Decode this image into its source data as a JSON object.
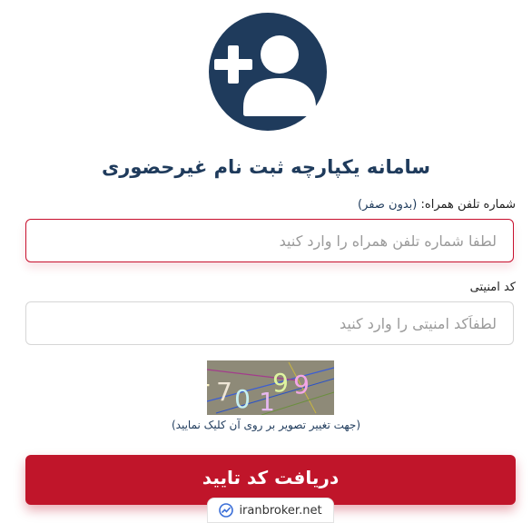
{
  "header": {
    "icon": "user-plus-icon",
    "title": "سامانه یکپارچه ثبت نام غیرحضوری",
    "accent_color": "#1f3b5c"
  },
  "phone": {
    "label": "شماره تلفن همراه:",
    "hint": "(بدون صفر)",
    "placeholder": "لطفا شماره تلفن همراه را وارد کنید"
  },
  "security": {
    "label": "کد امنیتی",
    "placeholder": "لطفاًکد امنیتی را وارد کنید"
  },
  "captcha": {
    "digits": [
      "1",
      "7",
      "0",
      "1",
      "9",
      "9"
    ],
    "hint": "(جهت تغییر تصویر بر روی آن کلیک نمایید)"
  },
  "submit": {
    "label": "دریافت کد تایید",
    "color": "#c0152a"
  },
  "watermark": {
    "text": "iranbroker.net",
    "icon": "chart-trend-icon"
  }
}
